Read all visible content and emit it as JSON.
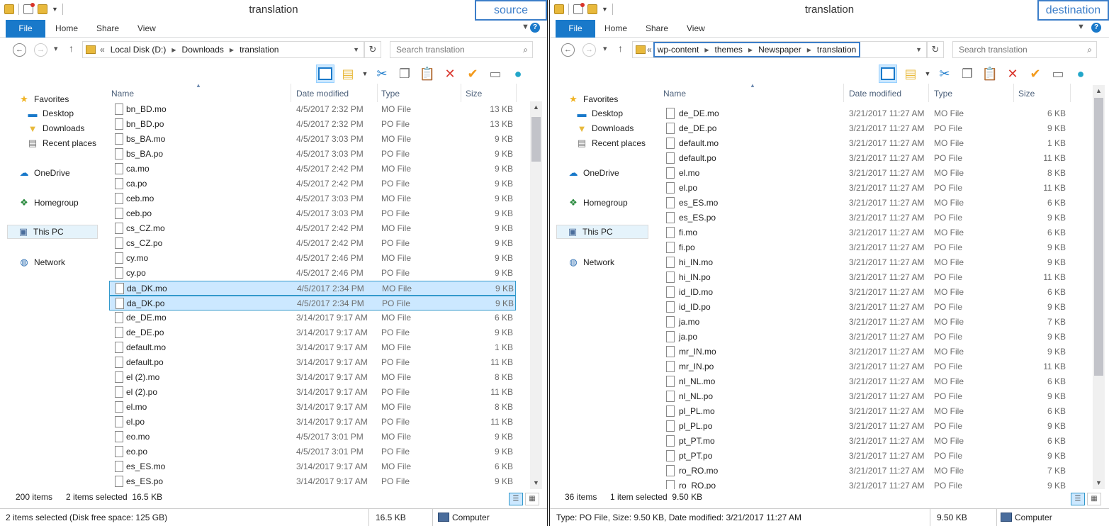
{
  "left": {
    "title": "translation",
    "tag": "source",
    "ribbon_tabs": [
      "File",
      "Home",
      "Share",
      "View"
    ],
    "address_crumbs": [
      "Local Disk (D:)",
      "Downloads",
      "translation"
    ],
    "search_placeholder": "Search translation",
    "nav_pane": [
      "Favorites",
      "Desktop",
      "Downloads",
      "Recent places",
      "OneDrive",
      "Homegroup",
      "This PC",
      "Network"
    ],
    "columns": {
      "name": "Name",
      "date": "Date modified",
      "type": "Type",
      "size": "Size"
    },
    "files": [
      {
        "name": "bn_BD.mo",
        "date": "4/5/2017 2:32 PM",
        "type": "MO File",
        "size": "13 KB",
        "selected": false
      },
      {
        "name": "bn_BD.po",
        "date": "4/5/2017 2:32 PM",
        "type": "PO File",
        "size": "13 KB",
        "selected": false
      },
      {
        "name": "bs_BA.mo",
        "date": "4/5/2017 3:03 PM",
        "type": "MO File",
        "size": "9 KB",
        "selected": false
      },
      {
        "name": "bs_BA.po",
        "date": "4/5/2017 3:03 PM",
        "type": "PO File",
        "size": "9 KB",
        "selected": false
      },
      {
        "name": "ca.mo",
        "date": "4/5/2017 2:42 PM",
        "type": "MO File",
        "size": "9 KB",
        "selected": false
      },
      {
        "name": "ca.po",
        "date": "4/5/2017 2:42 PM",
        "type": "PO File",
        "size": "9 KB",
        "selected": false
      },
      {
        "name": "ceb.mo",
        "date": "4/5/2017 3:03 PM",
        "type": "MO File",
        "size": "9 KB",
        "selected": false
      },
      {
        "name": "ceb.po",
        "date": "4/5/2017 3:03 PM",
        "type": "PO File",
        "size": "9 KB",
        "selected": false
      },
      {
        "name": "cs_CZ.mo",
        "date": "4/5/2017 2:42 PM",
        "type": "MO File",
        "size": "9 KB",
        "selected": false
      },
      {
        "name": "cs_CZ.po",
        "date": "4/5/2017 2:42 PM",
        "type": "PO File",
        "size": "9 KB",
        "selected": false
      },
      {
        "name": "cy.mo",
        "date": "4/5/2017 2:46 PM",
        "type": "MO File",
        "size": "9 KB",
        "selected": false
      },
      {
        "name": "cy.po",
        "date": "4/5/2017 2:46 PM",
        "type": "PO File",
        "size": "9 KB",
        "selected": false
      },
      {
        "name": "da_DK.mo",
        "date": "4/5/2017 2:34 PM",
        "type": "MO File",
        "size": "9 KB",
        "selected": true
      },
      {
        "name": "da_DK.po",
        "date": "4/5/2017 2:34 PM",
        "type": "PO File",
        "size": "9 KB",
        "selected": true
      },
      {
        "name": "de_DE.mo",
        "date": "3/14/2017 9:17 AM",
        "type": "MO File",
        "size": "6 KB",
        "selected": false
      },
      {
        "name": "de_DE.po",
        "date": "3/14/2017 9:17 AM",
        "type": "PO File",
        "size": "9 KB",
        "selected": false
      },
      {
        "name": "default.mo",
        "date": "3/14/2017 9:17 AM",
        "type": "MO File",
        "size": "1 KB",
        "selected": false
      },
      {
        "name": "default.po",
        "date": "3/14/2017 9:17 AM",
        "type": "PO File",
        "size": "11 KB",
        "selected": false
      },
      {
        "name": "el (2).mo",
        "date": "3/14/2017 9:17 AM",
        "type": "MO File",
        "size": "8 KB",
        "selected": false
      },
      {
        "name": "el (2).po",
        "date": "3/14/2017 9:17 AM",
        "type": "PO File",
        "size": "11 KB",
        "selected": false
      },
      {
        "name": "el.mo",
        "date": "3/14/2017 9:17 AM",
        "type": "MO File",
        "size": "8 KB",
        "selected": false
      },
      {
        "name": "el.po",
        "date": "3/14/2017 9:17 AM",
        "type": "PO File",
        "size": "11 KB",
        "selected": false
      },
      {
        "name": "eo.mo",
        "date": "4/5/2017 3:01 PM",
        "type": "MO File",
        "size": "9 KB",
        "selected": false
      },
      {
        "name": "eo.po",
        "date": "4/5/2017 3:01 PM",
        "type": "PO File",
        "size": "9 KB",
        "selected": false
      },
      {
        "name": "es_ES.mo",
        "date": "3/14/2017 9:17 AM",
        "type": "MO File",
        "size": "6 KB",
        "selected": false
      },
      {
        "name": "es_ES.po",
        "date": "3/14/2017 9:17 AM",
        "type": "PO File",
        "size": "9 KB",
        "selected": false
      }
    ],
    "item_count": "200 items",
    "selection_info": "2 items selected  16.5 KB",
    "status_text": "2 items selected (Disk free space: 125 GB)",
    "status_size": "16.5 KB",
    "status_location": "Computer"
  },
  "right": {
    "title": "translation",
    "tag": "destination",
    "ribbon_tabs": [
      "File",
      "Home",
      "Share",
      "View"
    ],
    "address_crumbs": [
      "wp-content",
      "themes",
      "Newspaper",
      "translation"
    ],
    "search_placeholder": "Search translation",
    "nav_pane": [
      "Favorites",
      "Desktop",
      "Downloads",
      "Recent places",
      "OneDrive",
      "Homegroup",
      "This PC",
      "Network"
    ],
    "columns": {
      "name": "Name",
      "date": "Date modified",
      "type": "Type",
      "size": "Size"
    },
    "files": [
      {
        "name": "de_DE.mo",
        "date": "3/21/2017 11:27 AM",
        "type": "MO File",
        "size": "6 KB",
        "selected": false
      },
      {
        "name": "de_DE.po",
        "date": "3/21/2017 11:27 AM",
        "type": "PO File",
        "size": "9 KB",
        "selected": false
      },
      {
        "name": "default.mo",
        "date": "3/21/2017 11:27 AM",
        "type": "MO File",
        "size": "1 KB",
        "selected": false
      },
      {
        "name": "default.po",
        "date": "3/21/2017 11:27 AM",
        "type": "PO File",
        "size": "11 KB",
        "selected": false
      },
      {
        "name": "el.mo",
        "date": "3/21/2017 11:27 AM",
        "type": "MO File",
        "size": "8 KB",
        "selected": false
      },
      {
        "name": "el.po",
        "date": "3/21/2017 11:27 AM",
        "type": "PO File",
        "size": "11 KB",
        "selected": false
      },
      {
        "name": "es_ES.mo",
        "date": "3/21/2017 11:27 AM",
        "type": "MO File",
        "size": "6 KB",
        "selected": false
      },
      {
        "name": "es_ES.po",
        "date": "3/21/2017 11:27 AM",
        "type": "PO File",
        "size": "9 KB",
        "selected": false
      },
      {
        "name": "fi.mo",
        "date": "3/21/2017 11:27 AM",
        "type": "MO File",
        "size": "6 KB",
        "selected": false
      },
      {
        "name": "fi.po",
        "date": "3/21/2017 11:27 AM",
        "type": "PO File",
        "size": "9 KB",
        "selected": false
      },
      {
        "name": "hi_IN.mo",
        "date": "3/21/2017 11:27 AM",
        "type": "MO File",
        "size": "9 KB",
        "selected": false
      },
      {
        "name": "hi_IN.po",
        "date": "3/21/2017 11:27 AM",
        "type": "PO File",
        "size": "11 KB",
        "selected": false
      },
      {
        "name": "id_ID.mo",
        "date": "3/21/2017 11:27 AM",
        "type": "MO File",
        "size": "6 KB",
        "selected": false
      },
      {
        "name": "id_ID.po",
        "date": "3/21/2017 11:27 AM",
        "type": "PO File",
        "size": "9 KB",
        "selected": false
      },
      {
        "name": "ja.mo",
        "date": "3/21/2017 11:27 AM",
        "type": "MO File",
        "size": "7 KB",
        "selected": false
      },
      {
        "name": "ja.po",
        "date": "3/21/2017 11:27 AM",
        "type": "PO File",
        "size": "9 KB",
        "selected": false
      },
      {
        "name": "mr_IN.mo",
        "date": "3/21/2017 11:27 AM",
        "type": "MO File",
        "size": "9 KB",
        "selected": false
      },
      {
        "name": "mr_IN.po",
        "date": "3/21/2017 11:27 AM",
        "type": "PO File",
        "size": "11 KB",
        "selected": false
      },
      {
        "name": "nl_NL.mo",
        "date": "3/21/2017 11:27 AM",
        "type": "MO File",
        "size": "6 KB",
        "selected": false
      },
      {
        "name": "nl_NL.po",
        "date": "3/21/2017 11:27 AM",
        "type": "PO File",
        "size": "9 KB",
        "selected": false
      },
      {
        "name": "pl_PL.mo",
        "date": "3/21/2017 11:27 AM",
        "type": "MO File",
        "size": "6 KB",
        "selected": false
      },
      {
        "name": "pl_PL.po",
        "date": "3/21/2017 11:27 AM",
        "type": "PO File",
        "size": "9 KB",
        "selected": false
      },
      {
        "name": "pt_PT.mo",
        "date": "3/21/2017 11:27 AM",
        "type": "MO File",
        "size": "6 KB",
        "selected": false
      },
      {
        "name": "pt_PT.po",
        "date": "3/21/2017 11:27 AM",
        "type": "PO File",
        "size": "9 KB",
        "selected": false
      },
      {
        "name": "ro_RO.mo",
        "date": "3/21/2017 11:27 AM",
        "type": "MO File",
        "size": "7 KB",
        "selected": false
      },
      {
        "name": "ro_RO.po",
        "date": "3/21/2017 11:27 AM",
        "type": "PO File",
        "size": "9 KB",
        "selected": false
      }
    ],
    "item_count": "36 items",
    "selection_info": "1 item selected  9.50 KB",
    "status_text": "Type: PO File, Size: 9.50 KB, Date modified: 3/21/2017 11:27 AM",
    "status_size": "9.50 KB",
    "status_location": "Computer"
  },
  "colors": {
    "accent": "#1979ca",
    "highlight_box": "#3c7ec9",
    "selection": "#cce8ff"
  }
}
